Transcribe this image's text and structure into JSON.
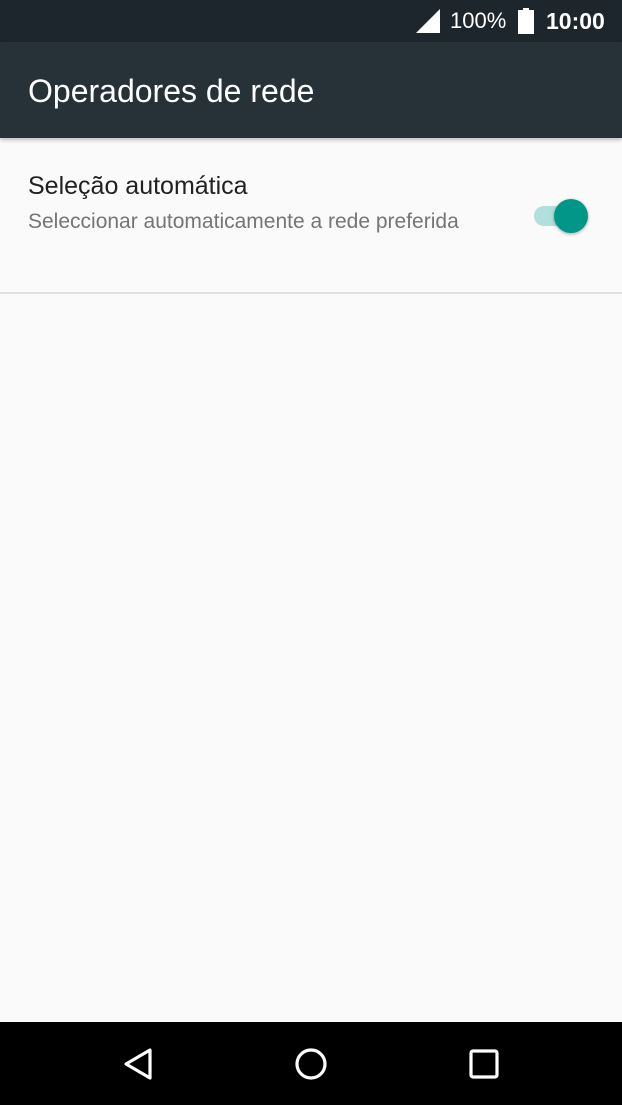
{
  "status_bar": {
    "signal_icon": "cell-signal-icon",
    "battery_text": "100%",
    "battery_icon": "battery-full-icon",
    "clock": "10:00"
  },
  "app_bar": {
    "title": "Operadores de rede"
  },
  "preference": {
    "title": "Seleção automática",
    "summary": "Seleccionar automaticamente a rede preferida",
    "toggle_on": true
  },
  "nav_bar": {
    "back_icon": "back-triangle-icon",
    "home_icon": "home-circle-icon",
    "recents_icon": "recents-square-icon"
  },
  "colors": {
    "status_bar": "#1e262d",
    "app_bar": "#263238",
    "background": "#fafafa",
    "accent": "#009688",
    "accent_track": "#b2dfdb"
  }
}
